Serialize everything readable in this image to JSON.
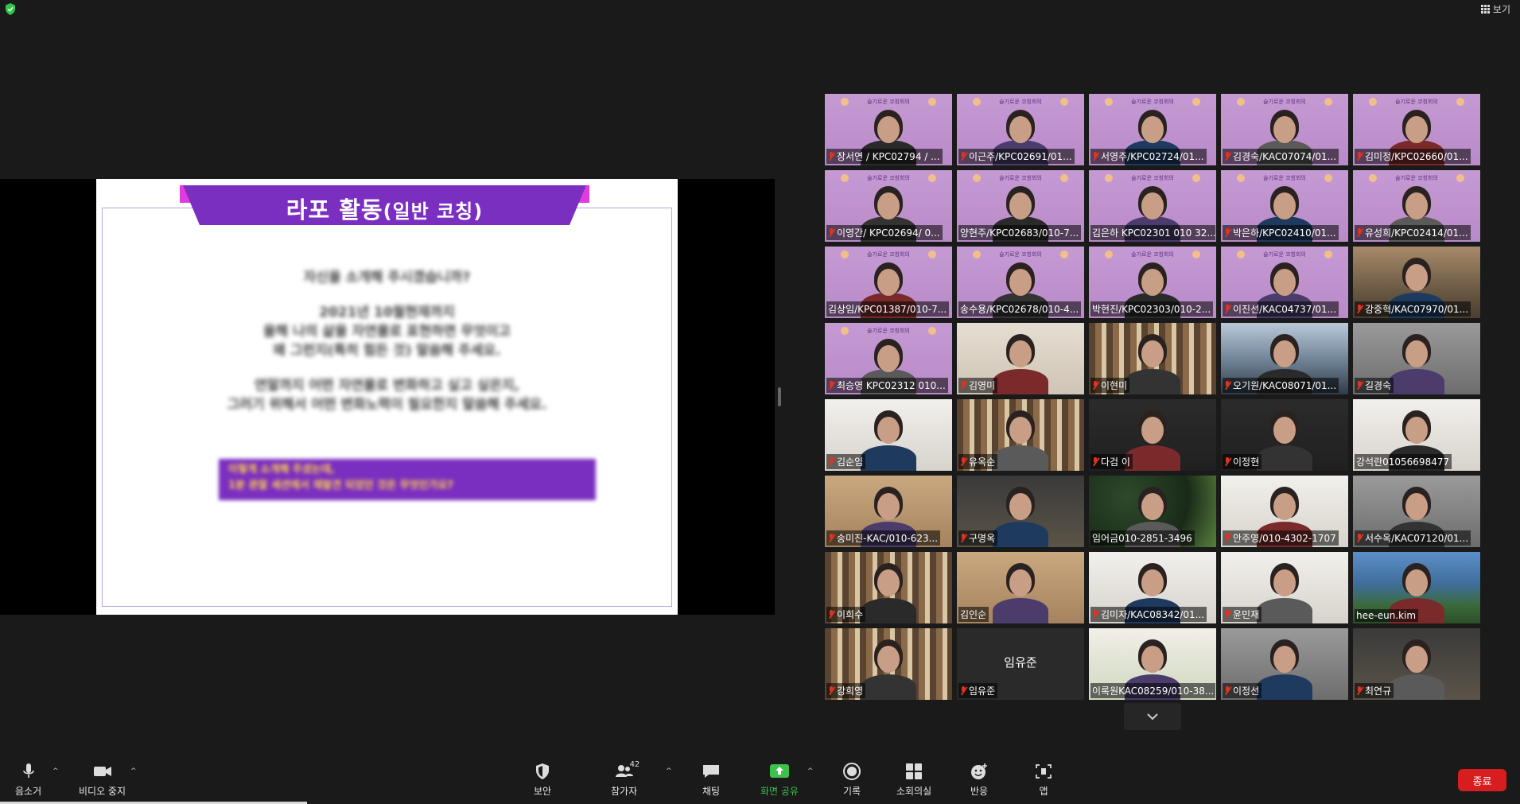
{
  "top_bar": {
    "view_label": "보기",
    "security_icon": "shield-check-icon"
  },
  "slide": {
    "title_main": "라포 활동",
    "title_paren": "(일반 코칭)",
    "body_lines": [
      "자신을 소개해 주시겠습니까?",
      "",
      "2021년 10월현재까지",
      "올해 나의 삶을 자연물로 표현하면 무엇이고",
      "왜 그런지(특히 힘든 것) 말씀해 주세요.",
      "",
      "연말까지 어떤 자연물로 변화하고 싶고 싶은지,",
      "그러기 위해서 어떤 변화노력이 필요한지 말씀해 주세요."
    ],
    "box_lines": [
      "이렇게 소개해 주셨는데,",
      "1분 관찰 세션에서 재발견 되었던 것은 무엇인가요?"
    ]
  },
  "banner_text": "슬기로운 코칭회의",
  "participants": [
    {
      "name": "장서연 / KPC02794 / ...",
      "style": "purple",
      "active": false,
      "muted": true
    },
    {
      "name": "이근주/KPC02691/01...",
      "style": "purple",
      "active": false,
      "muted": true
    },
    {
      "name": "서영주/KPC02724/01...",
      "style": "purple",
      "active": false,
      "muted": true
    },
    {
      "name": "김경숙/KAC07074/01...",
      "style": "purple",
      "active": false,
      "muted": true
    },
    {
      "name": "김미정/KPC02660/01...",
      "style": "purple",
      "active": false,
      "muted": true
    },
    {
      "name": "이영간/ KPC02694/ 0...",
      "style": "purple",
      "active": false,
      "muted": true
    },
    {
      "name": "양현주/KPC02683/010-7...",
      "style": "purple",
      "active": false,
      "muted": false
    },
    {
      "name": "김은하 KPC02301 010 32...",
      "style": "purple",
      "active": false,
      "muted": false
    },
    {
      "name": "박은하/KPC02410/01...",
      "style": "purple",
      "active": false,
      "muted": true
    },
    {
      "name": "유성희/KPC02414/01...",
      "style": "purple",
      "active": false,
      "muted": true
    },
    {
      "name": "김상임/KPC01387/010-7...",
      "style": "purple",
      "active": true,
      "muted": false
    },
    {
      "name": "송수용/KPC02678/010-4...",
      "style": "purple",
      "active": false,
      "muted": false
    },
    {
      "name": "박현진/KPC02303/010-2...",
      "style": "purple",
      "active": false,
      "muted": false
    },
    {
      "name": "이진선/KAC04737/01...",
      "style": "purple",
      "active": false,
      "muted": true
    },
    {
      "name": "강중혁/KAC07970/01...",
      "style": "cafe",
      "active": false,
      "muted": true
    },
    {
      "name": "최승영 KPC02312 010...",
      "style": "purple",
      "active": false,
      "muted": true
    },
    {
      "name": "김영미",
      "style": "beige",
      "active": false,
      "muted": true
    },
    {
      "name": "이현미",
      "style": "shelf",
      "active": false,
      "muted": true
    },
    {
      "name": "오기원/KAC08071/01...",
      "style": "city",
      "active": false,
      "muted": true
    },
    {
      "name": "길경숙",
      "style": "grey",
      "active": false,
      "muted": true
    },
    {
      "name": "김순임",
      "style": "white",
      "active": false,
      "muted": true
    },
    {
      "name": "유옥순",
      "style": "shelf",
      "active": false,
      "muted": true
    },
    {
      "name": "다검 이",
      "style": "dark",
      "active": false,
      "muted": true
    },
    {
      "name": "이정현",
      "style": "dark",
      "active": false,
      "muted": true
    },
    {
      "name": "강석란01056698477",
      "style": "white",
      "active": false,
      "muted": false
    },
    {
      "name": "송미진-KAC/010-623...",
      "style": "wood",
      "active": false,
      "muted": true
    },
    {
      "name": "구명옥",
      "style": "room",
      "active": false,
      "muted": true
    },
    {
      "name": "임어금010-2851-3496",
      "style": "grapes",
      "active": false,
      "muted": false
    },
    {
      "name": "안주영/010-4302-1707",
      "style": "white",
      "active": false,
      "muted": true
    },
    {
      "name": "서수옥/KAC07120/01...",
      "style": "grey",
      "active": false,
      "muted": true
    },
    {
      "name": "이희수",
      "style": "shelf",
      "active": false,
      "muted": true
    },
    {
      "name": "김인순",
      "style": "wood",
      "active": false,
      "muted": false
    },
    {
      "name": "김미자/KAC08342/01...",
      "style": "white",
      "active": false,
      "muted": true
    },
    {
      "name": "윤민재",
      "style": "white",
      "active": false,
      "muted": true
    },
    {
      "name": "hee-eun.kim",
      "style": "lake",
      "active": false,
      "muted": false
    },
    {
      "name": "강희영",
      "style": "shelf",
      "active": false,
      "muted": true
    },
    {
      "name": "임유준",
      "style": "nocam",
      "active": false,
      "muted": true
    },
    {
      "name": "이록원KAC08259/010-38...",
      "style": "flowers",
      "active": false,
      "muted": false
    },
    {
      "name": "이정선",
      "style": "grey",
      "active": false,
      "muted": true
    },
    {
      "name": "최연규",
      "style": "room",
      "active": false,
      "muted": true
    }
  ],
  "toolbar": {
    "mute_label": "음소거",
    "video_label": "비디오 중지",
    "security_label": "보안",
    "participants_label": "참가자",
    "participants_count": "42",
    "chat_label": "채팅",
    "share_label": "화면 공유",
    "record_label": "기록",
    "breakout_label": "소회의실",
    "reactions_label": "반응",
    "apps_label": "앱",
    "end_label": "종료"
  },
  "colors": {
    "accent_green": "#3cc14a",
    "end_red": "#d71d1d",
    "active_speaker": "#c9e04a",
    "banner_purple": "#7b2fc0"
  }
}
